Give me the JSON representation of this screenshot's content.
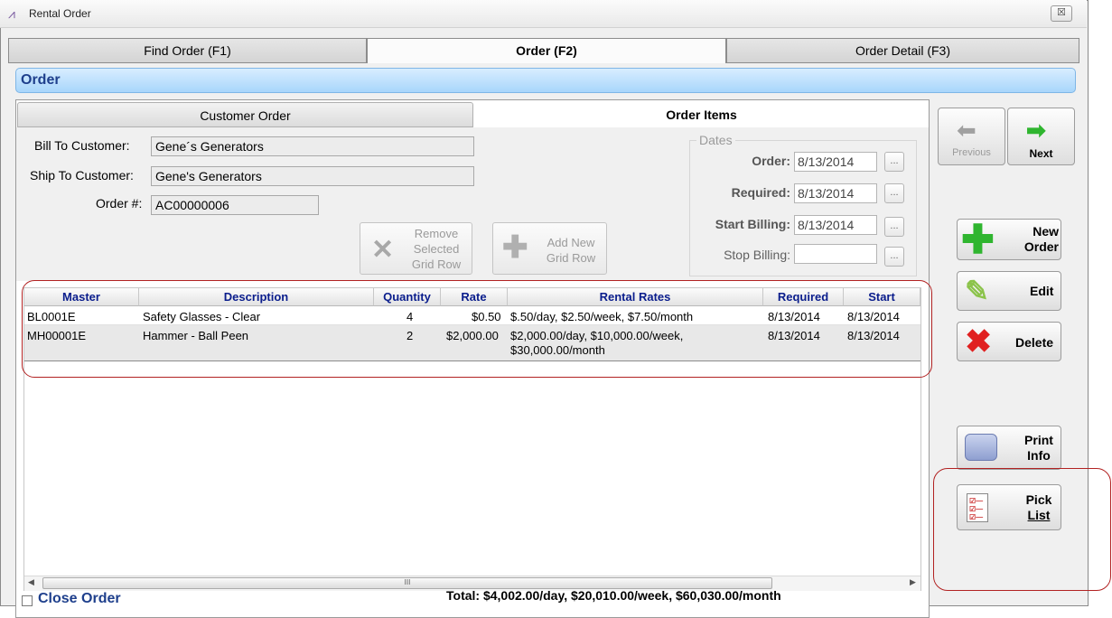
{
  "window": {
    "title": "Rental Order",
    "close_label": "☒"
  },
  "main_tabs": [
    {
      "label": "Find Order (F1)"
    },
    {
      "label": "Order (F2)"
    },
    {
      "label": "Order Detail (F3)"
    }
  ],
  "header": {
    "title": "Order"
  },
  "sub_tabs": [
    {
      "label": "Customer Order"
    },
    {
      "label": "Order Items"
    }
  ],
  "customer": {
    "bill_label": "Bill To Customer:",
    "bill_value": "Gene´s Generators",
    "ship_label": "Ship To Customer:",
    "ship_value": "Gene's Generators",
    "order_label": "Order #:",
    "order_value": "AC00000006"
  },
  "dates": {
    "title": "Dates",
    "order_label": "Order:",
    "order_value": "8/13/2014",
    "required_label": "Required:",
    "required_value": "8/13/2014",
    "start_label": "Start Billing:",
    "start_value": "8/13/2014",
    "stop_label": "Stop Billing:",
    "stop_value": "",
    "dots": "..."
  },
  "grid_buttons": {
    "remove_l1": "Remove",
    "remove_l2": "Selected",
    "remove_l3": "Grid Row",
    "add_l1": "Add New",
    "add_l2": "Grid Row"
  },
  "grid": {
    "columns": [
      "Master",
      "Description",
      "Quantity",
      "Rate",
      "Rental Rates",
      "Required",
      "Start"
    ],
    "rows": [
      {
        "master": "BL0001E",
        "description": "Safety Glasses - Clear",
        "quantity": "4",
        "rate": "$0.50",
        "rental_rates": "$.50/day,  $2.50/week,  $7.50/month",
        "rental_rates_2": "",
        "required": "8/13/2014",
        "start": "8/13/2014"
      },
      {
        "master": "MH00001E",
        "description": "Hammer - Ball Peen",
        "quantity": "2",
        "rate": "$2,000.00",
        "rental_rates": "$2,000.00/day,  $10,000.00/week,",
        "rental_rates_2": "$30,000.00/month",
        "required": "8/13/2014",
        "start": "8/13/2014"
      }
    ],
    "scroll_grip": "III"
  },
  "side_buttons": {
    "previous": "Previous",
    "next": "Next",
    "new_l1": "New",
    "new_l2": "Order",
    "edit": "Edit",
    "delete": "Delete",
    "print_l1": "Print",
    "print_l2": "Info",
    "pick_l1": "Pick",
    "pick_l2": "List"
  },
  "footer": {
    "total": "Total:   $4,002.00/day,  $20,010.00/week,  $60,030.00/month",
    "close_order": "Close Order"
  },
  "colors": {
    "header_blue": "#a8d6fb",
    "header_text": "#1e3f8c",
    "grid_header_text": "#0a1d8c",
    "highlight_red": "#b22222",
    "green": "#2fb52f",
    "delete_red": "#e02020"
  }
}
